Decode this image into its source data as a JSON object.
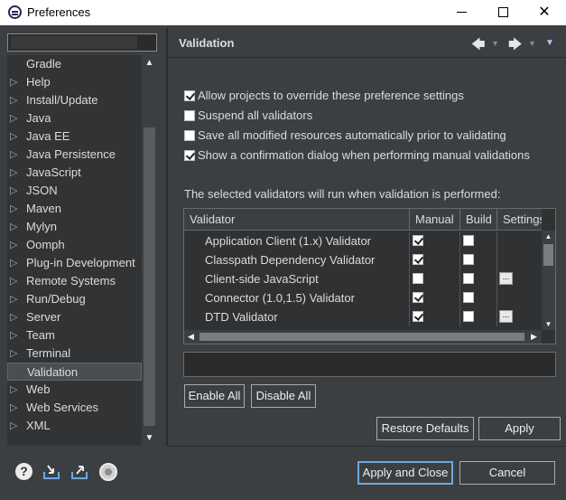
{
  "window": {
    "title": "Preferences"
  },
  "filter": {
    "placeholder": ""
  },
  "tree": {
    "items": [
      {
        "label": "Gradle",
        "expandable": false,
        "selected": false
      },
      {
        "label": "Help",
        "expandable": true,
        "selected": false
      },
      {
        "label": "Install/Update",
        "expandable": true,
        "selected": false
      },
      {
        "label": "Java",
        "expandable": true,
        "selected": false
      },
      {
        "label": "Java EE",
        "expandable": true,
        "selected": false
      },
      {
        "label": "Java Persistence",
        "expandable": true,
        "selected": false
      },
      {
        "label": "JavaScript",
        "expandable": true,
        "selected": false
      },
      {
        "label": "JSON",
        "expandable": true,
        "selected": false
      },
      {
        "label": "Maven",
        "expandable": true,
        "selected": false
      },
      {
        "label": "Mylyn",
        "expandable": true,
        "selected": false
      },
      {
        "label": "Oomph",
        "expandable": true,
        "selected": false
      },
      {
        "label": "Plug-in Development",
        "expandable": true,
        "selected": false
      },
      {
        "label": "Remote Systems",
        "expandable": true,
        "selected": false
      },
      {
        "label": "Run/Debug",
        "expandable": true,
        "selected": false
      },
      {
        "label": "Server",
        "expandable": true,
        "selected": false
      },
      {
        "label": "Team",
        "expandable": true,
        "selected": false
      },
      {
        "label": "Terminal",
        "expandable": true,
        "selected": false
      },
      {
        "label": "Validation",
        "expandable": false,
        "selected": true
      },
      {
        "label": "Web",
        "expandable": true,
        "selected": false
      },
      {
        "label": "Web Services",
        "expandable": true,
        "selected": false
      },
      {
        "label": "XML",
        "expandable": true,
        "selected": false
      }
    ]
  },
  "page": {
    "title": "Validation",
    "options": [
      {
        "label": "Allow projects to override these preference settings",
        "checked": true
      },
      {
        "label": "Suspend all validators",
        "checked": false
      },
      {
        "label": "Save all modified resources automatically prior to validating",
        "checked": false
      },
      {
        "label": "Show a confirmation dialog when performing manual validations",
        "checked": true
      }
    ],
    "info": "The selected validators will run when validation is performed:",
    "table": {
      "columns": [
        "Validator",
        "Manual",
        "Build",
        "Settings"
      ],
      "rows": [
        {
          "name": "Application Client (1.x) Validator",
          "manual": true,
          "build": false,
          "settings": false
        },
        {
          "name": "Classpath Dependency Validator",
          "manual": true,
          "build": false,
          "settings": false
        },
        {
          "name": "Client-side JavaScript",
          "manual": false,
          "build": false,
          "settings": true
        },
        {
          "name": "Connector (1.0,1.5) Validator",
          "manual": true,
          "build": false,
          "settings": false
        },
        {
          "name": "DTD Validator",
          "manual": true,
          "build": false,
          "settings": true
        }
      ]
    },
    "buttons": {
      "enable_all": "Enable All",
      "disable_all": "Disable All",
      "restore_defaults": "Restore Defaults",
      "apply": "Apply"
    }
  },
  "footer": {
    "apply_and_close": "Apply and Close",
    "cancel": "Cancel",
    "help_glyph": "?"
  },
  "icons": {
    "nav_back": "arrow-left-icon",
    "nav_forward": "arrow-right-icon",
    "view_menu": "view-menu-icon"
  }
}
